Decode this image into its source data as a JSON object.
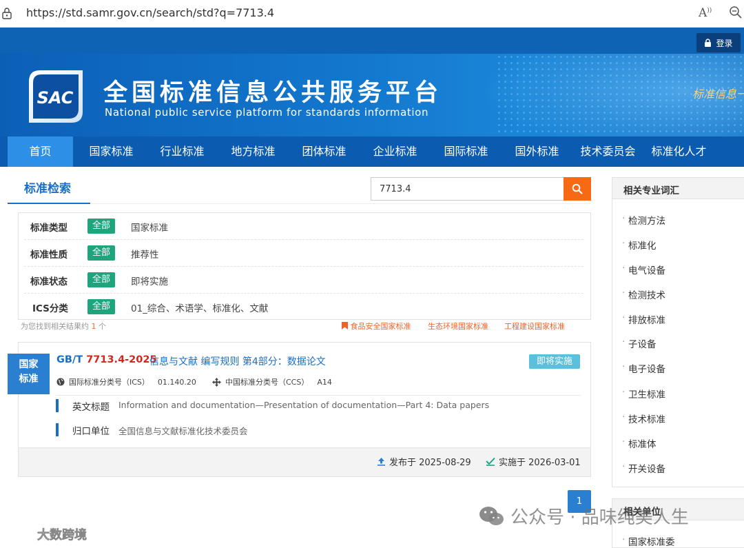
{
  "browser": {
    "url": "https://std.samr.gov.cn/search/std?q=7713.4",
    "read_aloud_glyph": "A",
    "read_aloud_super": "))"
  },
  "header": {
    "login_label": "登录",
    "logo_text": "SAC",
    "title": "全国标准信息公共服务平台",
    "subtitle": "National public service platform  for standards information",
    "slogan": "标准信息一"
  },
  "nav": {
    "items": [
      "首页",
      "国家标准",
      "行业标准",
      "地方标准",
      "团体标准",
      "企业标准",
      "国际标准",
      "国外标准",
      "技术委员会",
      "标准化人才"
    ],
    "active_index": 0
  },
  "search": {
    "section_title": "标准检索",
    "query": "7713.4"
  },
  "filters": [
    {
      "label": "标准类型",
      "all": "全部",
      "value": "国家标准"
    },
    {
      "label": "标准性质",
      "all": "全部",
      "value": "推荐性"
    },
    {
      "label": "标准状态",
      "all": "全部",
      "value": "即将实施"
    },
    {
      "label": "ICS分类",
      "all": "全部",
      "value": "01_综合、术语学、标准化、文献"
    }
  ],
  "results_summary": {
    "prefix": "为您找到相关结果约",
    "count": "1",
    "suffix": "个"
  },
  "quick_links": [
    "食品安全国家标准",
    "生态环境国家标准",
    "工程建设国家标准"
  ],
  "result": {
    "badge_line1": "国家",
    "badge_line2": "标准",
    "code_prefix": "GB/T ",
    "code_number": "7713.4-2025",
    "title": "信息与文献 编写规则 第4部分：数据论文",
    "status": "即将实施",
    "ics_label": "国际标准分类号（ICS）",
    "ics_value": "01.140.20",
    "ccs_label": "中国标准分类号（CCS）",
    "ccs_value": "A14",
    "english_title_label": "英文标题",
    "english_title": "Information and documentation—Presentation of documentation—Part 4: Data papers",
    "owner_label": "归口单位",
    "owner": "全国信息与文献标准化技术委员会",
    "published": "发布于 2025-08-29",
    "effective": "实施于 2026-03-01"
  },
  "pagination": {
    "current": "1"
  },
  "sidebar": {
    "terms_title": "相关专业词汇",
    "terms": [
      "检测方法",
      "标准化",
      "电气设备",
      "检测技术",
      "排放标准",
      "子设备",
      "电子设备",
      "卫生标准",
      "技术标准",
      "标准体",
      "开关设备"
    ],
    "units_title": "相关单位",
    "units": [
      "国家标准委"
    ]
  },
  "watermarks": {
    "wechat": "公众号 · 品味纯美人生",
    "brand": "大数跨境"
  },
  "colors": {
    "brand_blue": "#0b5cb0",
    "nav_active": "#2d8fe6",
    "accent_orange": "#f56a12",
    "tag_green": "#1ea57e",
    "status_cyan": "#5bc0de"
  }
}
